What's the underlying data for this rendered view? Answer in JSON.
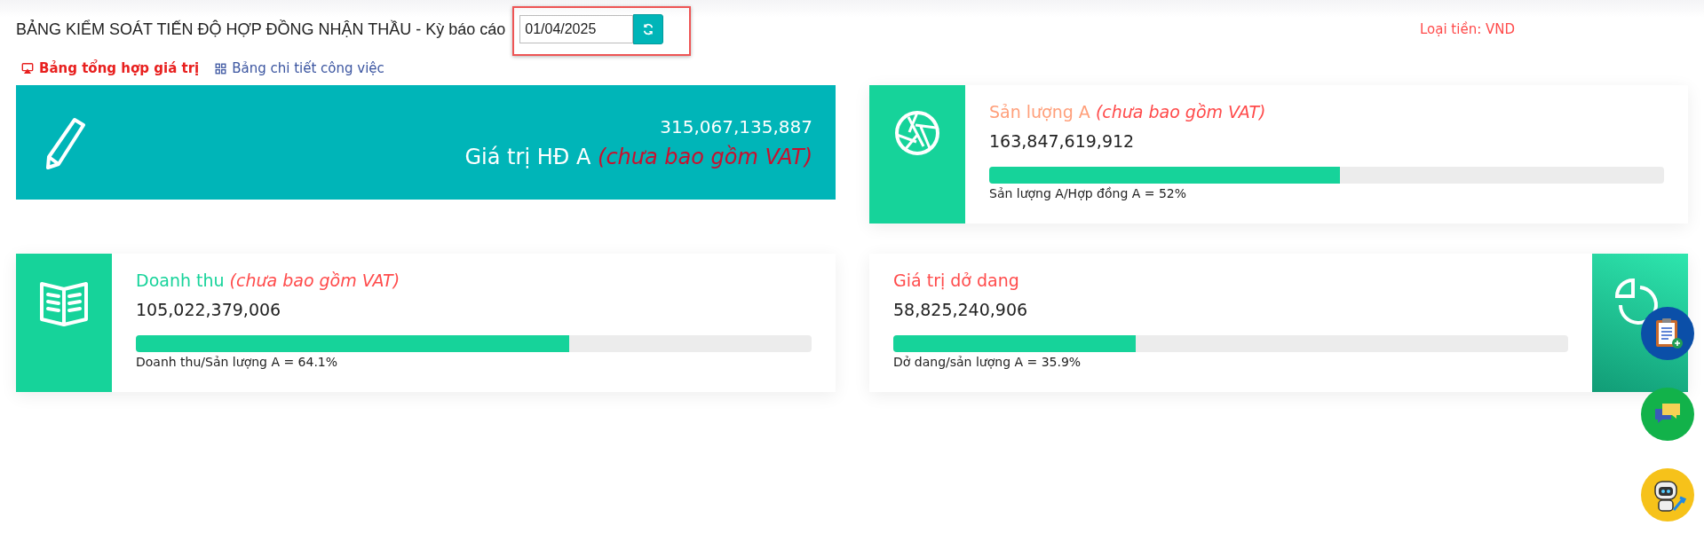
{
  "header": {
    "title": "BẢNG KIỂM SOÁT TIẾN ĐỘ HỢP ĐỒNG NHẬN THẦU - Kỳ báo cáo",
    "date": "01/04/2025",
    "currency": "Loại tiền: VND"
  },
  "tabs": [
    {
      "label": "Bảng tổng hợp giá trị",
      "selected": true
    },
    {
      "label": "Bảng chi tiết công việc",
      "selected": false
    }
  ],
  "hero": {
    "value": "315,067,135,887",
    "label": "Giá trị HĐ A",
    "note": "(chưa bao gồm VAT)"
  },
  "cards": [
    {
      "kind": "icon-left",
      "title": "Sản lượng A",
      "color": "#ff9f7a",
      "note": "(chưa bao gồm VAT)",
      "value": "163,847,619,912",
      "level": 0.52,
      "caption": "Sản lượng A/Hợp đồng A = 52%"
    },
    {
      "kind": "icon-left",
      "title": "Doanh thu",
      "color": "#16d39a",
      "note": "(chưa bao gồm VAT)",
      "value": "105,022,379,006",
      "level": 0.641,
      "caption": "Doanh thu/Sản lượng A = 64.1%"
    },
    {
      "kind": "icon-right",
      "title": "Giá trị dở dang",
      "color": "#ff4b4b",
      "value": "58,825,240,906",
      "level": 0.359,
      "caption": "Dở dang/sản lượng A = 35.9%"
    }
  ]
}
